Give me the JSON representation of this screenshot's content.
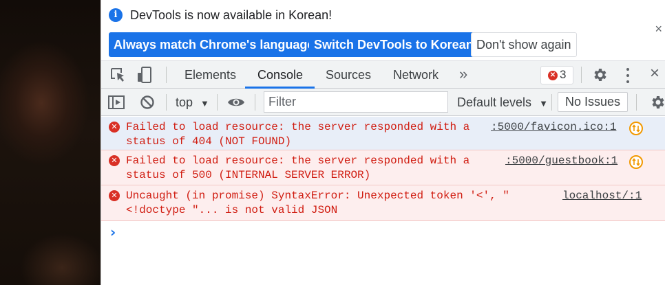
{
  "infobar": {
    "message": "DevTools is now available in Korean!",
    "info_icon": "i",
    "buttons": {
      "match": "Always match Chrome's language",
      "switch": "Switch DevTools to Korean",
      "dismiss": "Don't show again"
    },
    "close": "×"
  },
  "tabbar": {
    "icons": [
      "inspect-element-icon",
      "device-toolbar-icon"
    ],
    "tabs": [
      "Elements",
      "Console",
      "Sources",
      "Network"
    ],
    "active_tab": "Console",
    "more": "»",
    "error_count": "3",
    "settings_icon": "gear-icon",
    "close": "×"
  },
  "toolbar": {
    "context": "top",
    "filter_placeholder": "Filter",
    "levels": "Default levels",
    "issues": "No Issues"
  },
  "messages": [
    {
      "text": "Failed to load resource: the server responded with a\nstatus of 404 (NOT FOUND)",
      "source": ":5000/favicon.ico:1",
      "level": "error"
    },
    {
      "text": "Failed to load resource: the server responded with a\nstatus of 500 (INTERNAL SERVER ERROR)",
      "source": ":5000/guestbook:1",
      "level": "error"
    },
    {
      "text": "Uncaught (in promise) SyntaxError: Unexpected token '<', \"\n<!doctype \"... is not valid JSON",
      "source": "localhost/:1",
      "level": "error"
    }
  ],
  "prompt": "›",
  "colors": {
    "accent": "#1a73e8",
    "error": "#d93025",
    "error_text": "#d01b0f",
    "error_bg": "#fdeeee",
    "warning": "#f29900"
  }
}
